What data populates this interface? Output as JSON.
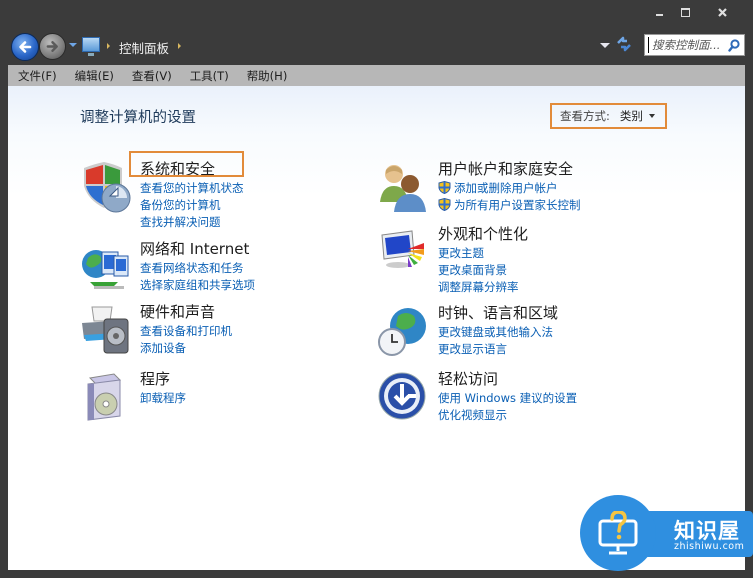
{
  "window": {
    "caption_buttons": [
      "minimize",
      "maximize",
      "close"
    ]
  },
  "navbar": {
    "breadcrumb": [
      "控制面板"
    ],
    "search_placeholder": "搜索控制面..."
  },
  "menubar": {
    "items": [
      "文件(F)",
      "编辑(E)",
      "查看(V)",
      "工具(T)",
      "帮助(H)"
    ]
  },
  "content": {
    "title": "调整计算机的设置",
    "view_by": {
      "label": "查看方式:",
      "value": "类别"
    },
    "categories": [
      {
        "title": "系统和安全",
        "icon": "shield-pie-icon",
        "links": [
          {
            "text": "查看您的计算机状态",
            "shield": false
          },
          {
            "text": "备份您的计算机",
            "shield": false
          },
          {
            "text": "查找并解决问题",
            "shield": false
          }
        ]
      },
      {
        "title": "网络和 Internet",
        "icon": "network-globe-icon",
        "links": [
          {
            "text": "查看网络状态和任务",
            "shield": false
          },
          {
            "text": "选择家庭组和共享选项",
            "shield": false
          }
        ]
      },
      {
        "title": "硬件和声音",
        "icon": "printer-speaker-icon",
        "links": [
          {
            "text": "查看设备和打印机",
            "shield": false
          },
          {
            "text": "添加设备",
            "shield": false
          }
        ]
      },
      {
        "title": "程序",
        "icon": "program-box-icon",
        "links": [
          {
            "text": "卸载程序",
            "shield": false
          }
        ]
      },
      {
        "title": "用户帐户和家庭安全",
        "icon": "users-icon",
        "links": [
          {
            "text": "添加或删除用户帐户",
            "shield": true
          },
          {
            "text": "为所有用户设置家长控制",
            "shield": true
          }
        ]
      },
      {
        "title": "外观和个性化",
        "icon": "monitor-palette-icon",
        "links": [
          {
            "text": "更改主题",
            "shield": false
          },
          {
            "text": "更改桌面背景",
            "shield": false
          },
          {
            "text": "调整屏幕分辨率",
            "shield": false
          }
        ]
      },
      {
        "title": "时钟、语言和区域",
        "icon": "clock-globe-icon",
        "links": [
          {
            "text": "更改键盘或其他输入法",
            "shield": false
          },
          {
            "text": "更改显示语言",
            "shield": false
          }
        ]
      },
      {
        "title": "轻松访问",
        "icon": "ease-of-access-icon",
        "links": [
          {
            "text": "使用 Windows 建议的设置",
            "shield": false
          },
          {
            "text": "优化视频显示",
            "shield": false
          }
        ]
      }
    ]
  },
  "colors": {
    "link": "#0a5fb4",
    "highlight_box": "#e28b3a",
    "menubar_bg": "#b7b7b7",
    "frame": "#3b3b3b"
  },
  "watermark": {
    "name": "知识屋",
    "url": "zhishiwu.com"
  }
}
